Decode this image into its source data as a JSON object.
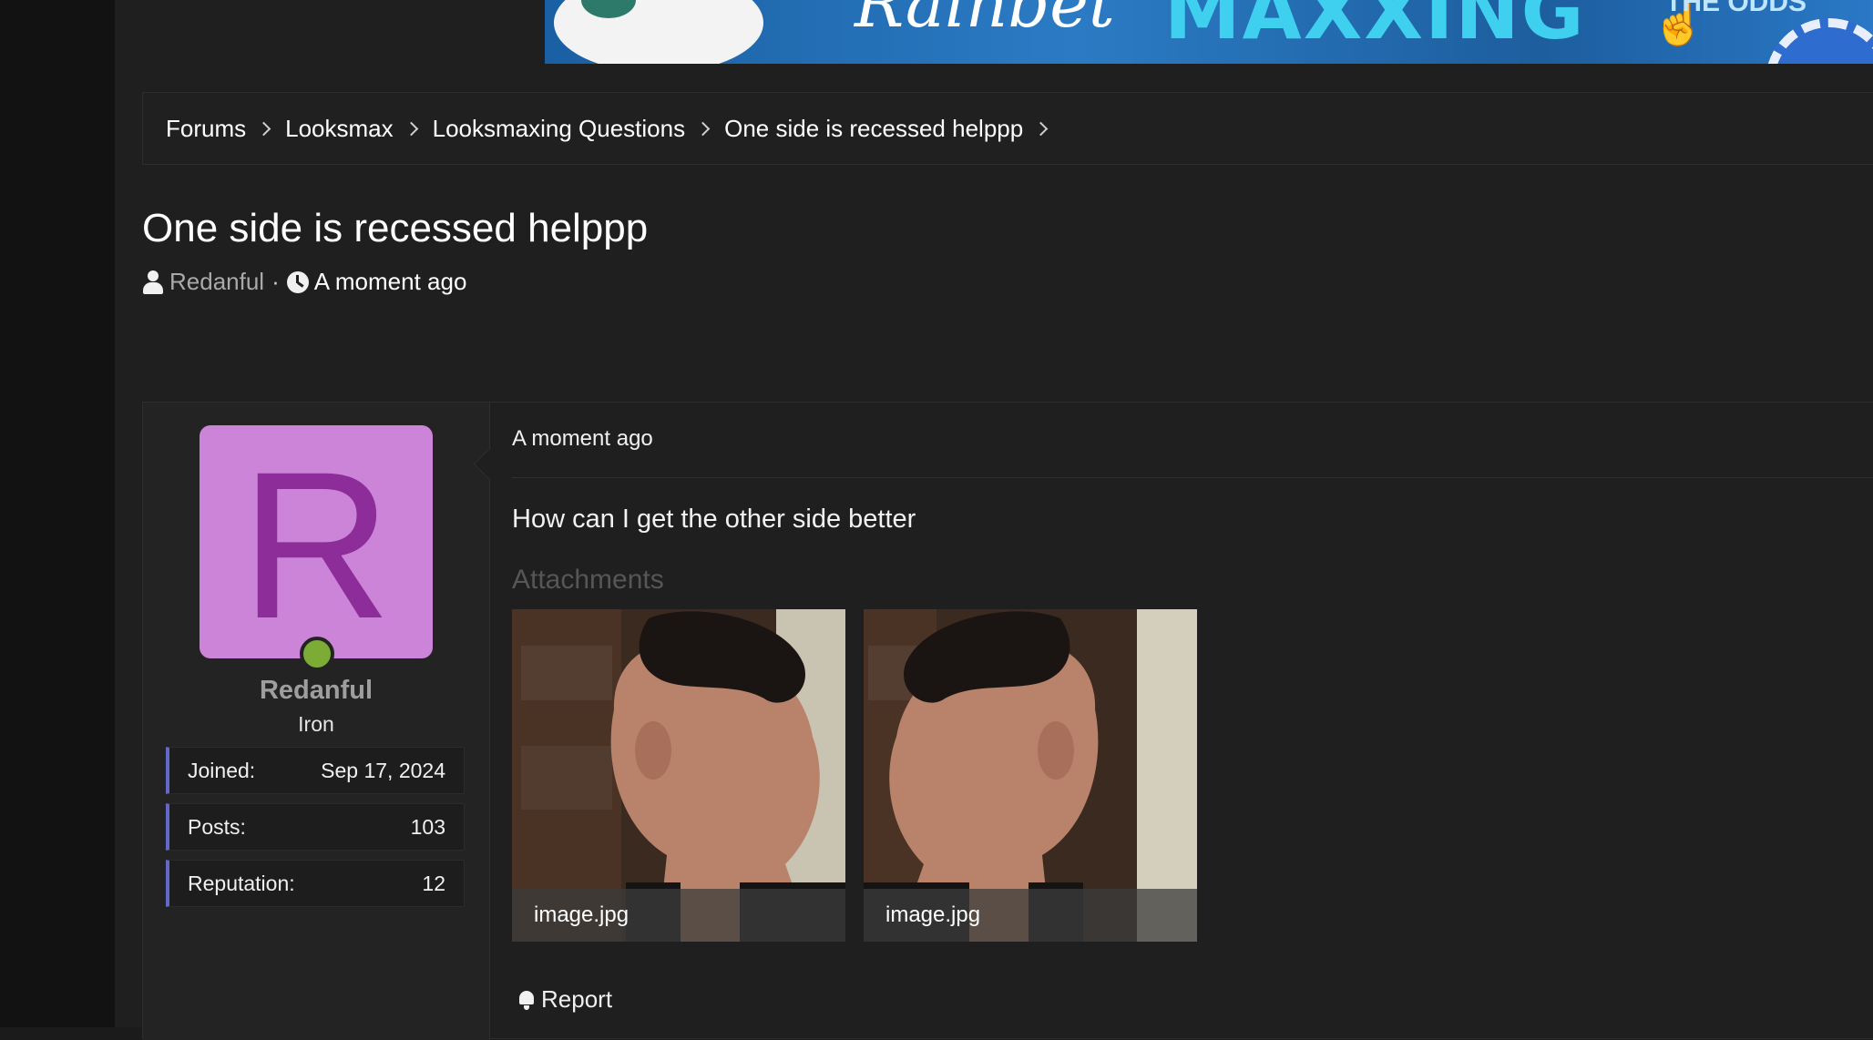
{
  "banner": {
    "script_text": "Rainbet",
    "headline": "MAXXING",
    "odds_text": "THE ODDS"
  },
  "breadcrumb": {
    "items": [
      {
        "label": "Forums"
      },
      {
        "label": "Looksmax"
      },
      {
        "label": "Looksmaxing Questions"
      },
      {
        "label": "One side is recessed helppp"
      }
    ]
  },
  "thread": {
    "title": "One side is recessed helppp",
    "author": "Redanful",
    "separator": "·",
    "time": "A moment ago"
  },
  "user": {
    "avatar_letter": "R",
    "avatar_bg": "#cc84d8",
    "avatar_fg": "#8c2d9a",
    "online_color": "#7cac35",
    "name": "Redanful",
    "title": "Iron",
    "stats": [
      {
        "label": "Joined:",
        "value": "Sep 17, 2024"
      },
      {
        "label": "Posts:",
        "value": "103"
      },
      {
        "label": "Reputation:",
        "value": "12"
      }
    ]
  },
  "post": {
    "time": "A moment ago",
    "message": "How can I get the other side better",
    "attachments_title": "Attachments",
    "attachments": [
      {
        "filename": "image.jpg"
      },
      {
        "filename": "image.jpg"
      }
    ],
    "report_label": "Report"
  },
  "colors": {
    "accent": "#6367c7",
    "background": "#1f1f1f"
  }
}
